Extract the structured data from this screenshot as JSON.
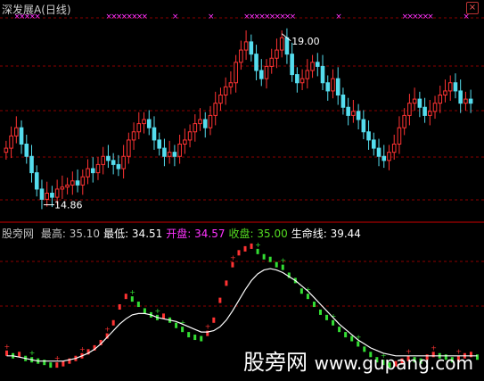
{
  "top_panel": {
    "title": "深发展A",
    "period": "(日线)",
    "high_label": "19.00",
    "low_label": "14.86"
  },
  "indicator_header": {
    "name": "股旁网",
    "items": [
      {
        "label": "最高:",
        "value": "35.10",
        "label_color": "#c0c0c0",
        "value_color": "#c0c0c0"
      },
      {
        "label": "最低:",
        "value": "34.51",
        "label_color": "#ffffff",
        "value_color": "#ffffff"
      },
      {
        "label": "开盘:",
        "value": "34.57",
        "label_color": "#ff33ff",
        "value_color": "#ff33ff"
      },
      {
        "label": "收盘:",
        "value": "35.00",
        "label_color": "#55dd22",
        "value_color": "#55dd22"
      },
      {
        "label": "生命线:",
        "value": "39.44",
        "label_color": "#ffffff",
        "value_color": "#ffffff"
      }
    ]
  },
  "watermark": {
    "text": "股旁网",
    "url": "www.gupang.com"
  },
  "colors": {
    "up": "#ff3333",
    "down": "#55ddee",
    "grid": "#8b0000",
    "marker": "#ff33ff",
    "line": "#ffffff",
    "osc_up": "#ff3333",
    "osc_down": "#33dd33"
  },
  "chart_data": [
    {
      "type": "candlestick",
      "ylim": [
        14.5,
        19.3
      ],
      "marked": {
        "high": 19.0,
        "low": 14.86
      },
      "closes": [
        16.2,
        16.5,
        16.7,
        16.3,
        16.0,
        15.6,
        15.2,
        14.95,
        15.1,
        15.0,
        15.2,
        15.25,
        15.3,
        15.4,
        15.3,
        15.5,
        15.7,
        15.6,
        15.8,
        16.0,
        15.9,
        15.8,
        15.7,
        16.0,
        16.4,
        16.6,
        16.8,
        16.9,
        16.7,
        16.4,
        16.2,
        16.0,
        16.1,
        16.0,
        16.3,
        16.4,
        16.6,
        16.8,
        16.9,
        16.7,
        17.0,
        17.3,
        17.5,
        17.7,
        17.8,
        18.3,
        18.6,
        18.8,
        18.5,
        18.1,
        17.9,
        18.2,
        18.4,
        18.6,
        18.9,
        18.5,
        18.0,
        17.8,
        17.9,
        18.1,
        18.3,
        18.2,
        17.8,
        17.6,
        17.9,
        17.5,
        17.2,
        17.0,
        17.1,
        16.9,
        16.6,
        16.4,
        16.2,
        16.0,
        15.9,
        16.1,
        16.3,
        16.7,
        17.0,
        17.3,
        17.4,
        17.2,
        17.0,
        17.1,
        17.3,
        17.5,
        17.6,
        17.8,
        17.6,
        17.3,
        17.4,
        17.3
      ]
    },
    {
      "type": "oscillator",
      "ylim": [
        0,
        100
      ],
      "values": [
        15,
        13,
        14,
        11,
        10,
        9,
        8,
        6,
        6,
        7,
        9,
        11,
        13,
        16,
        19,
        23,
        28,
        38,
        50,
        58,
        56,
        52,
        47,
        44,
        42,
        43,
        40,
        36,
        33,
        29,
        27,
        26,
        30,
        40,
        55,
        68,
        82,
        91,
        94,
        96,
        92,
        88,
        86,
        82,
        80,
        74,
        70,
        62,
        58,
        52,
        46,
        42,
        38,
        33,
        29,
        26,
        22,
        18,
        14,
        10,
        8,
        6,
        7,
        9,
        11,
        10,
        9,
        12,
        14,
        13,
        12,
        10,
        11,
        13,
        14,
        12
      ],
      "life_line": [
        13,
        13,
        12,
        11,
        10,
        9,
        9,
        9,
        9,
        9,
        10,
        11,
        13,
        15,
        18,
        22,
        27,
        32,
        37,
        41,
        44,
        45,
        45,
        44,
        42,
        41,
        40,
        39,
        37,
        35,
        33,
        31,
        31,
        32,
        35,
        40,
        47,
        55,
        63,
        70,
        75,
        78,
        79,
        78,
        76,
        73,
        70,
        66,
        62,
        57,
        52,
        47,
        42,
        37,
        33,
        29,
        25,
        22,
        19,
        17,
        15,
        14,
        13,
        13,
        13,
        13,
        13,
        13,
        13,
        13,
        13,
        13,
        13,
        13,
        13,
        13
      ]
    }
  ]
}
